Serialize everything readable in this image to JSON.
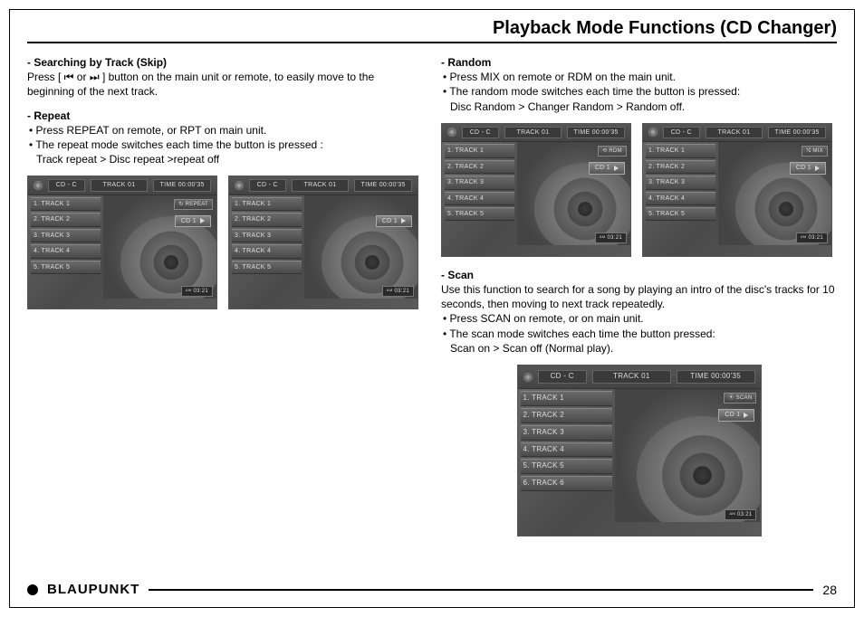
{
  "page": {
    "title": "Playback Mode Functions (CD Changer)",
    "number": "28",
    "brand": "BLAUPUNKT"
  },
  "left": {
    "skip": {
      "heading": "- Searching by Track (Skip)",
      "text": "Press [ ⏮ or ⏭ ] button on the main unit or remote, to easily move to the beginning of the next track."
    },
    "repeat": {
      "heading": "- Repeat",
      "b1": "Press REPEAT on remote, or RPT on main unit.",
      "b2": "The repeat mode switches each time the button is pressed :",
      "b2_indent": "Track repeat > Disc repeat >repeat off"
    }
  },
  "right": {
    "random": {
      "heading": "- Random",
      "b1": "Press MIX on remote or RDM on the main unit.",
      "b2": "The random mode switches each time the button is pressed:",
      "b2_indent": "Disc Random > Changer Random > Random off."
    },
    "scan": {
      "heading": "- Scan",
      "intro": "Use this function to search for a song by playing an intro of the disc's tracks for 10 seconds, then moving to next track repeatedly.",
      "b1": "Press SCAN on remote, or on main unit.",
      "b2": "The scan mode switches each time the button pressed:",
      "b2_indent": "Scan on > Scan off (Normal play)."
    }
  },
  "ui": {
    "source": "CD - C",
    "track_label": "TRACK",
    "track_no": "01",
    "time_label": "TIME",
    "time": "00:00'35",
    "tracks": [
      "1. TRACK 1",
      "2. TRACK 2",
      "3. TRACK 3",
      "4. TRACK 4",
      "5. TRACK 5"
    ],
    "tracks6": [
      "1. TRACK 1",
      "2. TRACK 2",
      "3. TRACK 3",
      "4. TRACK 4",
      "5. TRACK 5",
      "6. TRACK 6"
    ],
    "cd": "CD 1",
    "clock_am": "AM",
    "clock": "03:21",
    "badges": {
      "repeat": "↻ REPEAT",
      "rdm": "⟲ RDM",
      "mix": "⤭ MIX",
      "scan": "⦿ SCAN"
    }
  }
}
